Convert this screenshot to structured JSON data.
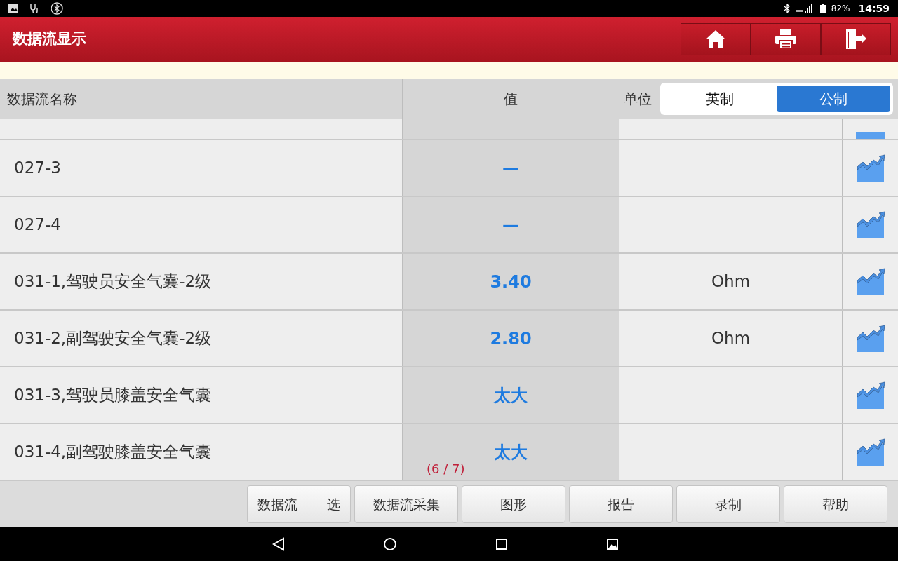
{
  "status_bar": {
    "battery": "82%",
    "time": "14:59"
  },
  "header": {
    "title": "数据流显示"
  },
  "table": {
    "columns": [
      "数据流名称",
      "值",
      "单位"
    ],
    "unit_systems": [
      {
        "label": "英制",
        "selected": false
      },
      {
        "label": "公制",
        "selected": true
      }
    ],
    "rows": [
      {
        "name": "027-3",
        "value": "—",
        "unit": ""
      },
      {
        "name": "027-4",
        "value": "—",
        "unit": ""
      },
      {
        "name": "031-1,驾驶员安全气囊-2级",
        "value": "3.40",
        "unit": "Ohm"
      },
      {
        "name": "031-2,副驾驶安全气囊-2级",
        "value": "2.80",
        "unit": "Ohm"
      },
      {
        "name": "031-3,驾驶员膝盖安全气囊",
        "value": "太大",
        "unit": ""
      },
      {
        "name": "031-4,副驾驶膝盖安全气囊",
        "value": "太大",
        "unit": ""
      }
    ],
    "page": "(6 / 7)"
  },
  "toolbar": [
    {
      "parts": [
        "数据流",
        "选"
      ]
    },
    {
      "parts": [
        "数据流采集"
      ]
    },
    {
      "parts": [
        "图形"
      ]
    },
    {
      "parts": [
        "报告"
      ]
    },
    {
      "parts": [
        "录制"
      ]
    },
    {
      "parts": [
        "帮助"
      ]
    }
  ]
}
